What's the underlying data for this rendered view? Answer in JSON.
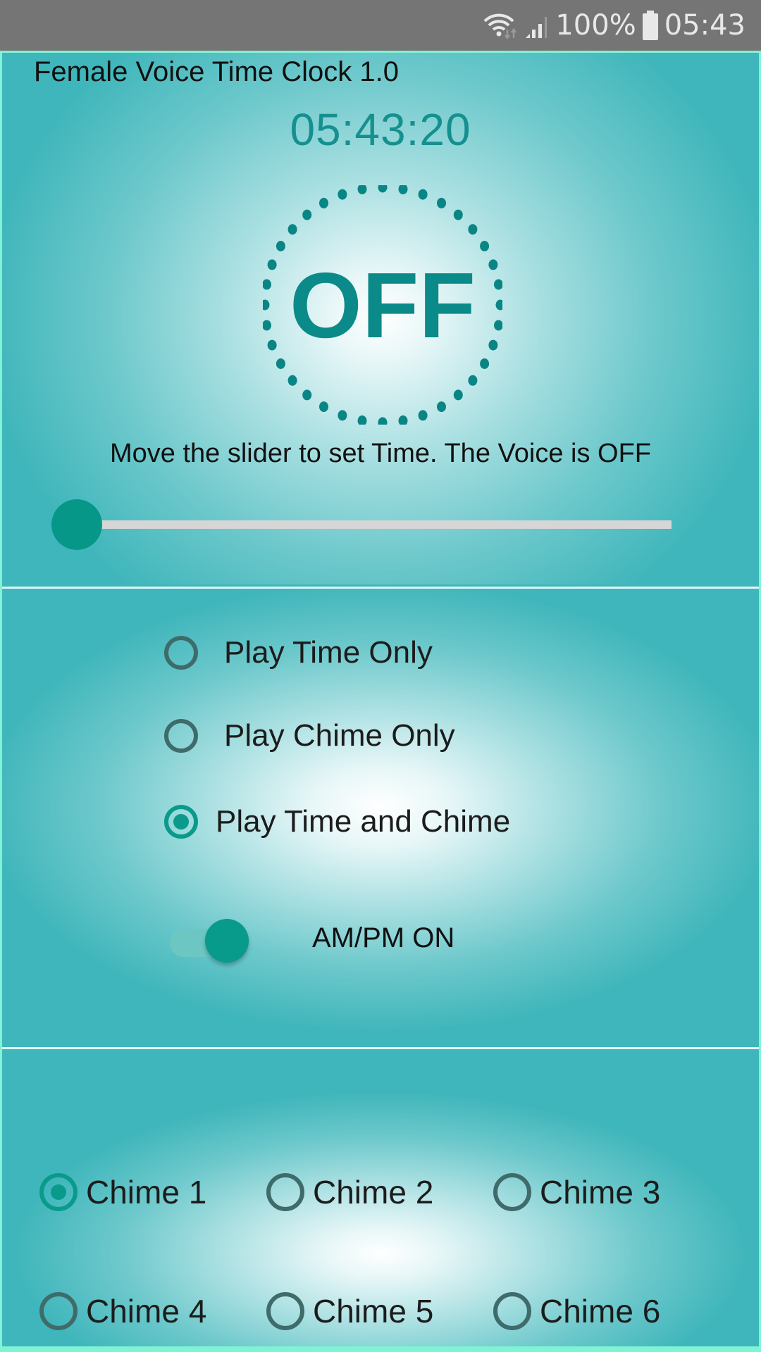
{
  "status_bar": {
    "wifi_icon": "wifi-icon",
    "signal_icon": "signal-icon",
    "battery_percent": "100%",
    "battery_icon": "battery-icon",
    "time": "05:43"
  },
  "app": {
    "title": "Female Voice Time Clock 1.0",
    "clock": "05:43:20",
    "voice_state": "OFF",
    "hint": "Move the slider to set Time. The Voice is OFF",
    "slider": {
      "value_fraction": 0.0
    },
    "play_modes": [
      {
        "label": "Play Time Only",
        "checked": false
      },
      {
        "label": "Play Chime Only",
        "checked": false
      },
      {
        "label": "Play Time and Chime",
        "checked": true
      }
    ],
    "ampm": {
      "label": "AM/PM ON",
      "on": true
    },
    "chimes": [
      {
        "label": "Chime 1",
        "checked": true
      },
      {
        "label": "Chime 2",
        "checked": false
      },
      {
        "label": "Chime 3",
        "checked": false
      },
      {
        "label": "Chime 4",
        "checked": false
      },
      {
        "label": "Chime 5",
        "checked": false
      },
      {
        "label": "Chime 6",
        "checked": false
      }
    ]
  },
  "colors": {
    "accent": "#079789",
    "clock_text": "#16908f",
    "background": "#3fb6bb",
    "status_bar": "#757575"
  }
}
